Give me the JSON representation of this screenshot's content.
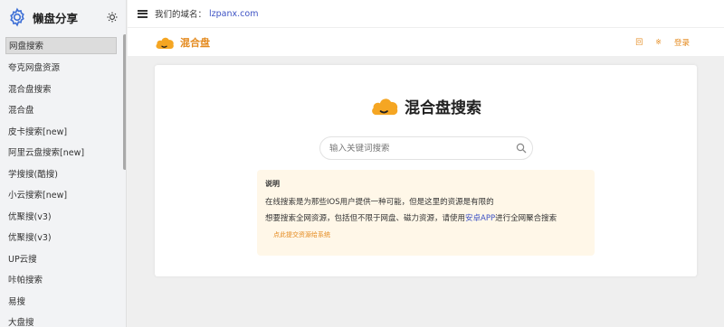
{
  "sidebar": {
    "brand_title": "懒盘分享",
    "items": [
      {
        "label": "网盘搜索",
        "active": true
      },
      {
        "label": "夸克网盘资源"
      },
      {
        "label": "混合盘搜索"
      },
      {
        "label": "混合盘"
      },
      {
        "label": "皮卡搜索[new]"
      },
      {
        "label": "阿里云盘搜索[new]"
      },
      {
        "label": "学搜搜(酷搜)"
      },
      {
        "label": "小云搜索[new]"
      },
      {
        "label": "优聚搜(v3)"
      },
      {
        "label": "优聚搜(v3)"
      },
      {
        "label": "UP云搜"
      },
      {
        "label": "咔帕搜索"
      },
      {
        "label": "易搜"
      },
      {
        "label": "大盘搜"
      }
    ]
  },
  "topbar": {
    "domain_label": "我们的域名：",
    "domain_link": "lzpanx.com"
  },
  "header": {
    "site_name": "混合盘",
    "icon1": "回",
    "icon2": "※",
    "login": "登录"
  },
  "main": {
    "hero_title": "混合盘搜索",
    "search_placeholder": "输入关键词搜索",
    "notice": {
      "title": "说明",
      "line1": "在线搜索是为那些IOS用户提供一种可能，但是这里的资源是有限的",
      "line2_prefix": "想要搜索全网资源，包括但不限于网盘、磁力资源，请使用",
      "line2_link": "安卓APP",
      "line2_suffix": "进行全网聚合搜索",
      "feedback_link": "点此提交资源给系统"
    }
  },
  "colors": {
    "accent": "#e48a1e",
    "cloud": "#f5a623",
    "link": "#3d52c4",
    "notice_bg": "#fff7e8"
  }
}
